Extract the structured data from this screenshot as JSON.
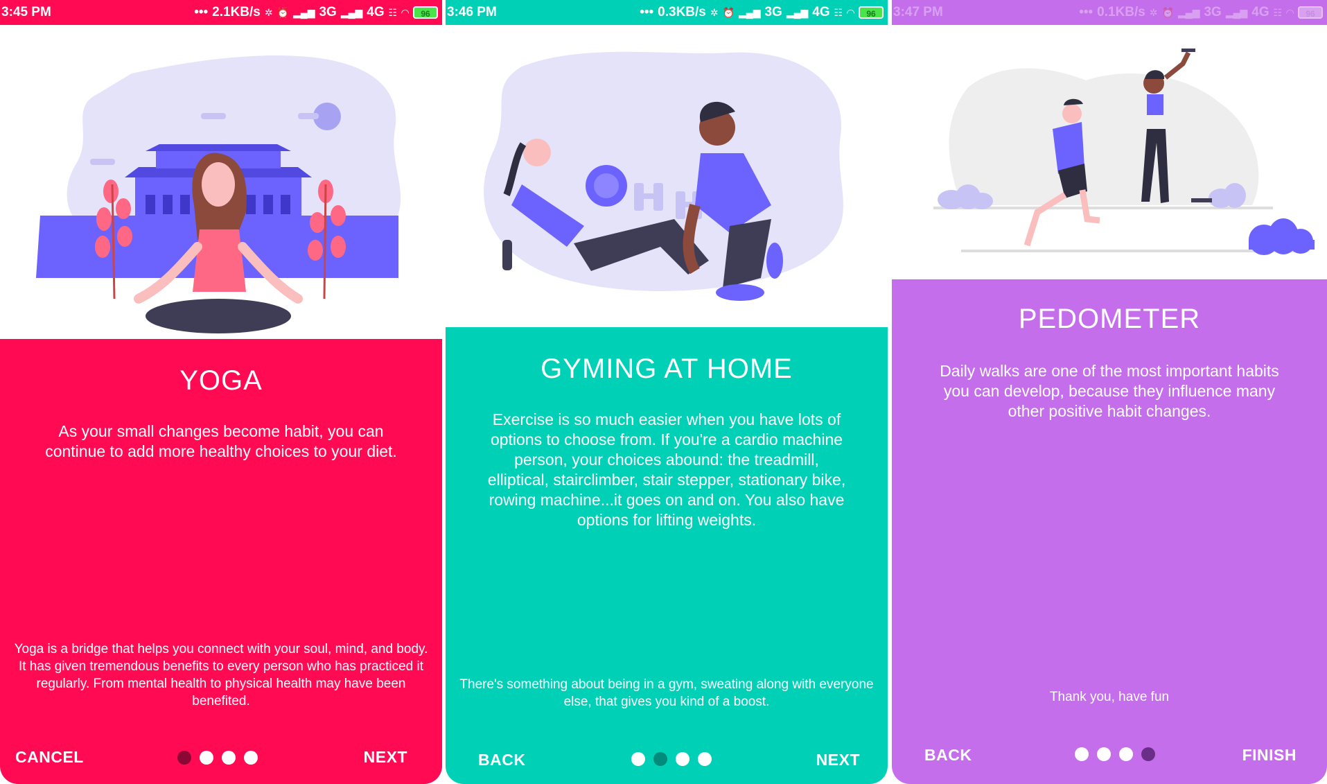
{
  "screens": [
    {
      "status": {
        "time": "3:45 PM",
        "speed": "2.1KB/s",
        "network": "3G",
        "network2": "4G",
        "battery": "96"
      },
      "title": "YOGA",
      "description": "As your small changes become habit, you can continue to add more healthy choices to your diet.",
      "footer": "Yoga is a bridge that helps you connect with your soul, mind, and body. It has given tremendous benefits to every person who has practiced it regularly. From mental health to physical health may have been benefited.",
      "left_button": "CANCEL",
      "right_button": "NEXT",
      "page_index": 1,
      "page_count": 4,
      "colors": {
        "background": "#FF0A53",
        "active_dot": "#8C0733"
      }
    },
    {
      "status": {
        "time": "3:46 PM",
        "speed": "0.3KB/s",
        "network": "3G",
        "network2": "4G",
        "battery": "96"
      },
      "title": "GYMING AT HOME",
      "description": "Exercise is so much easier when you have lots of options to choose from. If you're a cardio machine person, your choices abound: the treadmill, elliptical, stairclimber, stair stepper, stationary bike, rowing machine...it goes on and on. You also have options for lifting weights.",
      "footer": "There's something about being in a gym, sweating along with everyone else, that gives you kind of a boost.",
      "left_button": "BACK",
      "right_button": "NEXT",
      "page_index": 2,
      "page_count": 4,
      "colors": {
        "background": "#00D1B6",
        "active_dot": "#008B7A"
      }
    },
    {
      "status": {
        "time": "3:47 PM",
        "speed": "0.1KB/s",
        "network": "3G",
        "network2": "4G",
        "battery": "96"
      },
      "title": "PEDOMETER",
      "description": "Daily walks are one of the most important habits you can develop, because they influence many other positive habit changes.",
      "footer": "Thank you, have fun",
      "left_button": "BACK",
      "right_button": "FINISH",
      "page_index": 4,
      "page_count": 4,
      "colors": {
        "background": "#C56EEB",
        "active_dot": "#6A2E89"
      }
    }
  ]
}
